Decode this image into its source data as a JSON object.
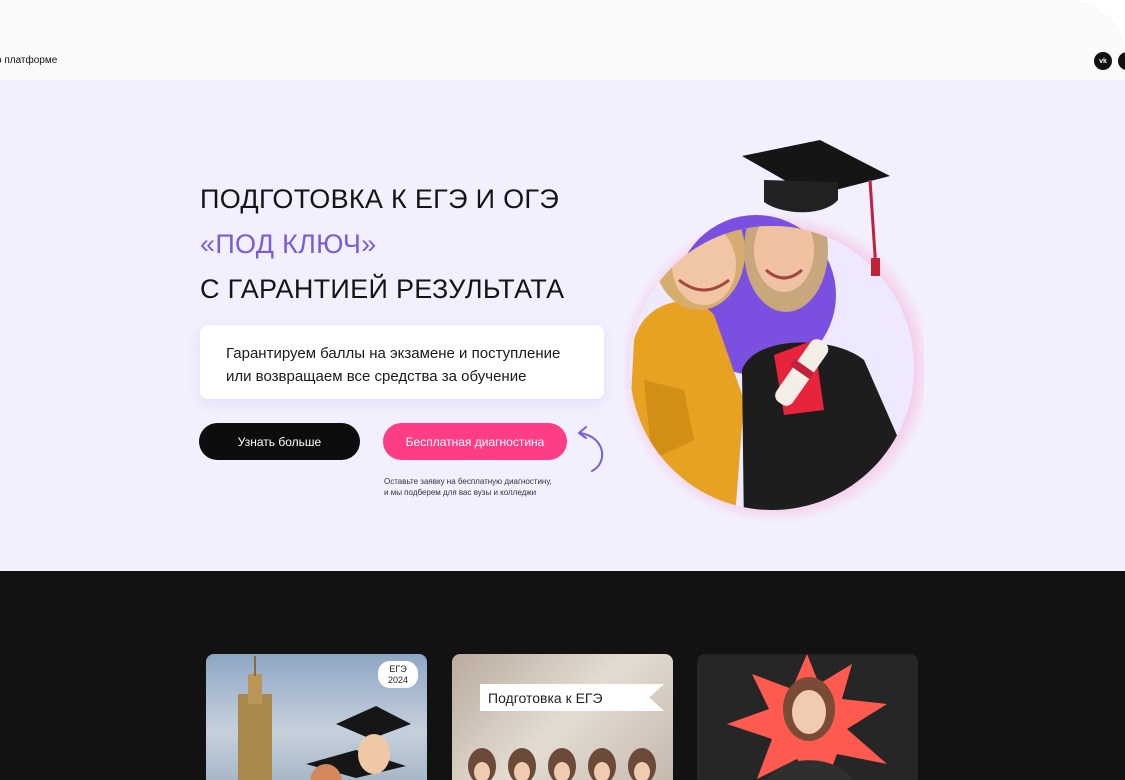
{
  "topbar": {
    "link_text": "о платформе",
    "social": [
      {
        "label": "vk",
        "icon": "vk-icon"
      },
      {
        "label": "",
        "icon": "social-icon"
      }
    ]
  },
  "hero": {
    "headline_line1": "ПОДГОТОВКА К ЕГЭ И ОГЭ",
    "headline_line2": "«ПОД КЛЮЧ»",
    "headline_line3": "С ГАРАНТИЕЙ РЕЗУЛЬТАТА",
    "guarantee_line1": "Гарантируем баллы на экзамене и поступление",
    "guarantee_line2": "или возвращаем все средства за обучение",
    "btn_more": "Узнать больше",
    "btn_diagnostics": "Бесплатная диагностина",
    "note_line1": "Оставьте заявку на бесплатную диагностину,",
    "note_line2": "и мы подберем для вас вузы и колледжи",
    "accent_color": "#7a5cd6",
    "cta_color": "#ff3d86"
  },
  "cards": [
    {
      "badge_line1": "ЕГЭ",
      "badge_line2": "2024"
    },
    {
      "banner": "Подготовка к ЕГЭ"
    },
    {}
  ]
}
